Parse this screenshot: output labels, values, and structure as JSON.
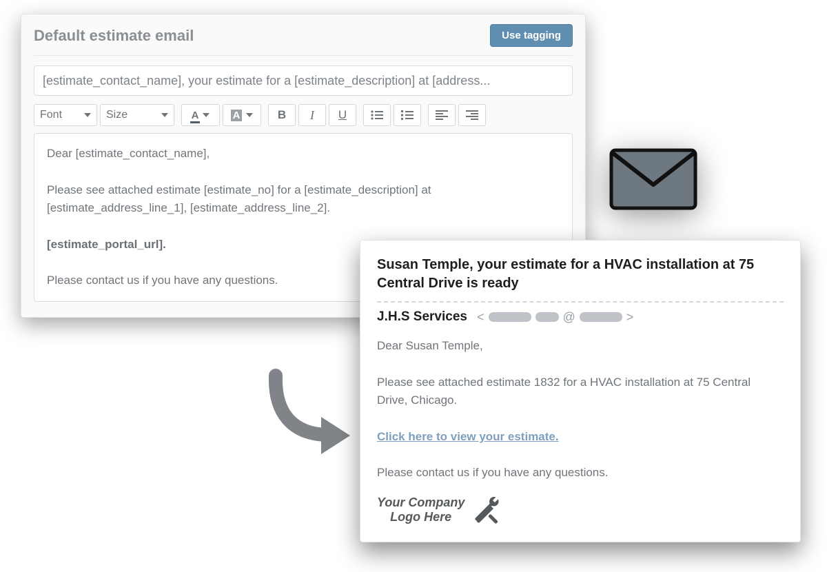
{
  "editor": {
    "title": "Default estimate email",
    "tagging_button": "Use tagging",
    "subject_value": "[estimate_contact_name], your estimate for a [estimate_description] at [address...",
    "toolbar": {
      "font_label": "Font",
      "size_label": "Size"
    },
    "body": {
      "line1": "Dear [estimate_contact_name],",
      "line2": "Please see attached estimate [estimate_no] for a [estimate_description] at [estimate_address_line_1], [estimate_address_line_2].",
      "line3": "[estimate_portal_url].",
      "line4": "Please contact us if you have any questions."
    }
  },
  "preview": {
    "subject": "Susan Temple, your estimate for a HVAC installation at 75 Central Drive is ready",
    "from_name": "J.H.S Services",
    "at_symbol": "@",
    "body": {
      "line1": "Dear Susan Temple,",
      "line2": "Please see attached estimate 1832 for a HVAC installation at 75 Central Drive, Chicago.",
      "link_text": "Click here to view your estimate.",
      "line4": "Please contact us if you have any questions."
    },
    "logo_line1": "Your Company",
    "logo_line2": "Logo Here"
  }
}
